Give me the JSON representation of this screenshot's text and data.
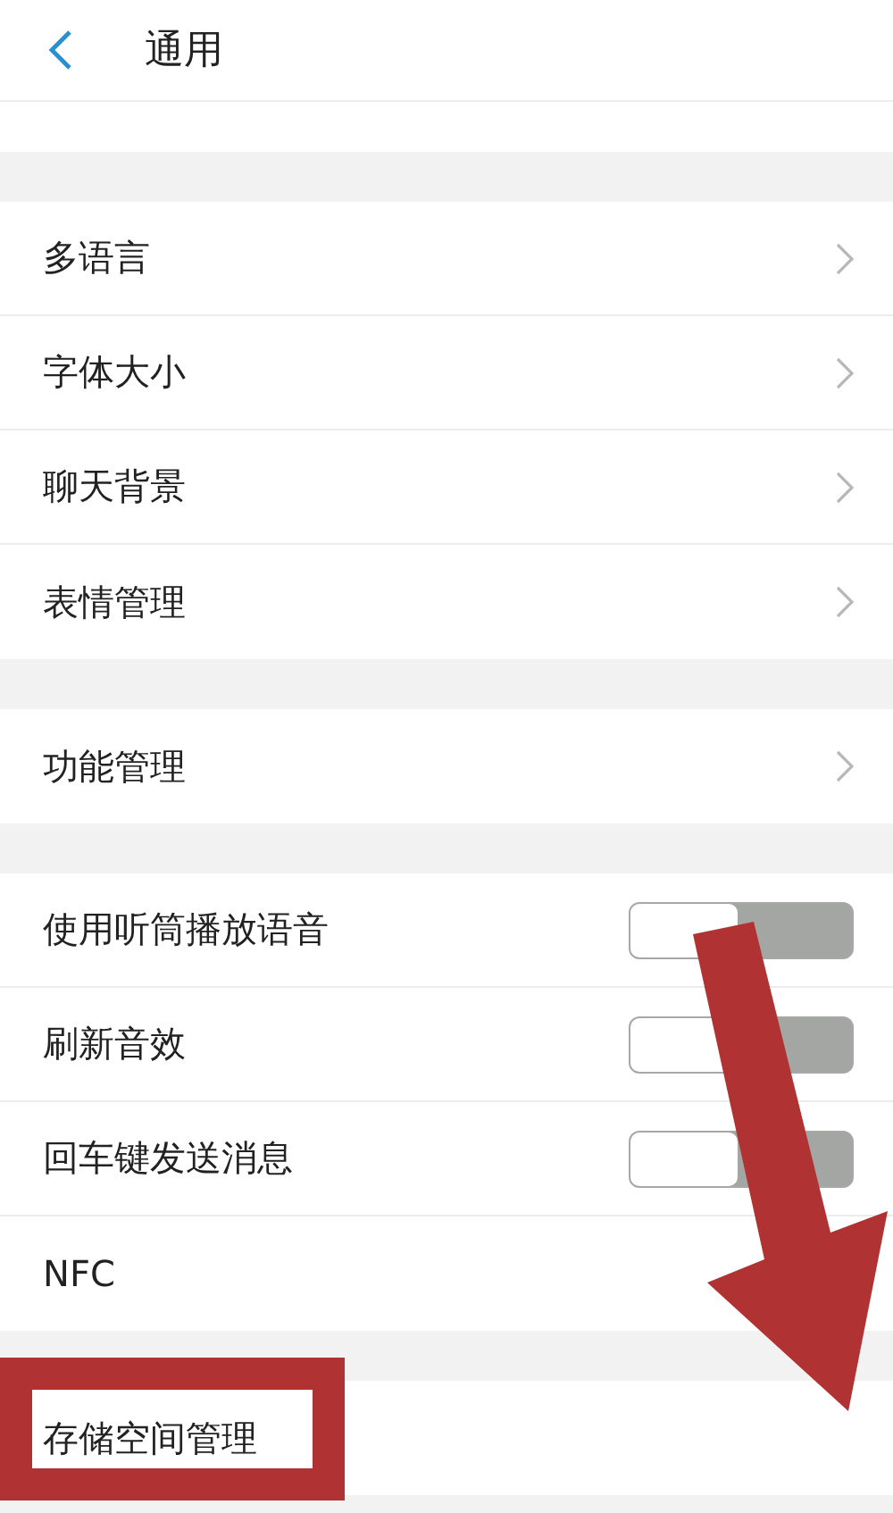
{
  "header": {
    "title": "通用"
  },
  "groups": [
    {
      "rows": [
        {
          "kind": "link",
          "label": "多语言"
        },
        {
          "kind": "link",
          "label": "字体大小"
        },
        {
          "kind": "link",
          "label": "聊天背景"
        },
        {
          "kind": "link",
          "label": "表情管理"
        }
      ]
    },
    {
      "rows": [
        {
          "kind": "link",
          "label": "功能管理"
        }
      ]
    },
    {
      "rows": [
        {
          "kind": "toggle",
          "label": "使用听筒播放语音",
          "on": false
        },
        {
          "kind": "toggle",
          "label": "刷新音效",
          "on": false
        },
        {
          "kind": "toggle",
          "label": "回车键发送消息",
          "on": false
        },
        {
          "kind": "plain",
          "label": "NFC"
        }
      ]
    },
    {
      "rows": [
        {
          "kind": "plain",
          "label": "存储空间管理",
          "highlighted": true
        }
      ]
    }
  ],
  "annotation": {
    "kind": "arrow"
  }
}
